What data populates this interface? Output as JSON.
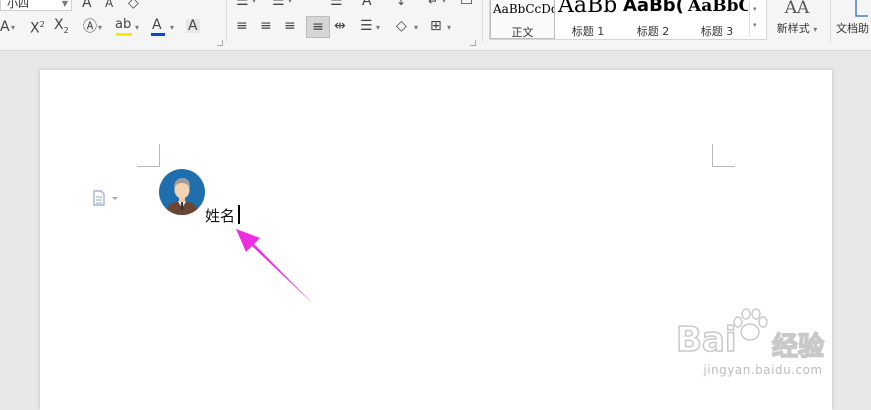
{
  "ribbon": {
    "font_size_value": "小四",
    "styles": [
      {
        "preview": "AaBbCcDd",
        "caption": "正文"
      },
      {
        "preview": "AaBb",
        "caption": "标题 1"
      },
      {
        "preview": "AaBb(",
        "caption": "标题 2"
      },
      {
        "preview": "AaBbCc",
        "caption": "标题 3"
      }
    ],
    "new_style_label": "新样式",
    "doc_helper_label": "文档助",
    "new_style_icon_text": "AA"
  },
  "document": {
    "text": "姓名"
  },
  "watermark": {
    "brand": "Bai",
    "brand_cn": "经验",
    "url": "jingyan.baidu.com"
  },
  "colors": {
    "highlight_yellow": "#ffe800",
    "font_color_blue": "#1a3fd8",
    "arrow_magenta": "#ee2de0",
    "avatar_blue": "#1f6fae"
  }
}
